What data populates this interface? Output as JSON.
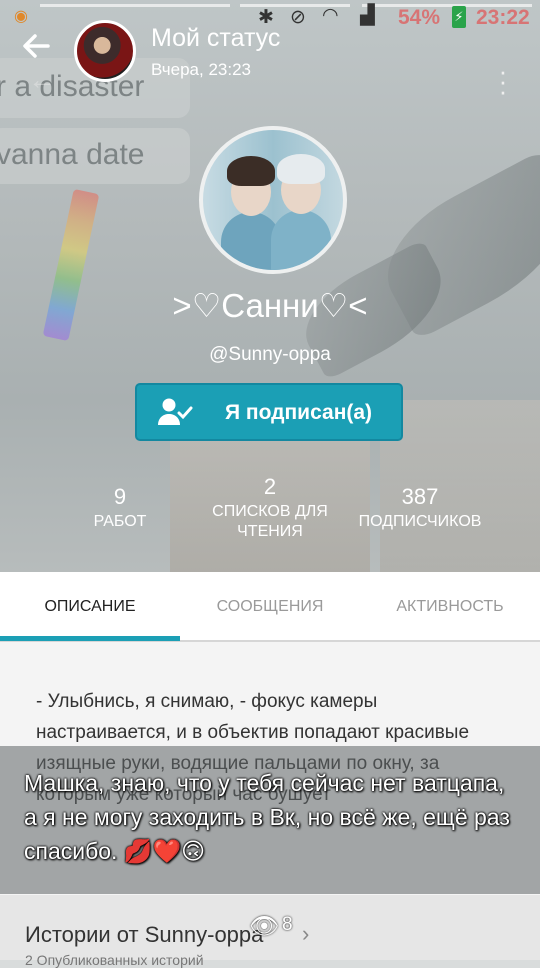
{
  "status_bar": {
    "battery": "54%",
    "time": "23:22"
  },
  "story": {
    "title": "Мой статус",
    "time": "Вчера, 23:23",
    "caption": "Машка, знаю, что у тебя сейчас нет ватцапа, а я не могу заходить в Вк, но всё же, ещё раз спасибо. 💋❤️🙃",
    "views": "8"
  },
  "background_text": {
    "line1": "r a disaster",
    "line2": "vanna date"
  },
  "profile": {
    "name": ">♡Санни♡<",
    "handle": "@Sunny-oppa",
    "follow_label": "Я подписан(а)"
  },
  "stats": [
    {
      "value": "9",
      "label": "РАБОТ"
    },
    {
      "value": "2",
      "label": "СПИСКОВ ДЛЯ ЧТЕНИЯ"
    },
    {
      "value": "387",
      "label": "ПОДПИСЧИКОВ"
    }
  ],
  "tabs": [
    "ОПИСАНИЕ",
    "СООБЩЕНИЯ",
    "АКТИВНОСТЬ"
  ],
  "description": "- Улыбнись, я снимаю, - фокус камеры настраивается, и в объектив попадают красивые изящные руки, водящие пальцами по окну, за которым уже который час бушует",
  "stories": {
    "title": "Истории от Sunny-oppa",
    "subtitle": "2 Опубликованных историй"
  },
  "colors": {
    "accent": "#1b9fb5",
    "status_red": "#e05a5a"
  }
}
